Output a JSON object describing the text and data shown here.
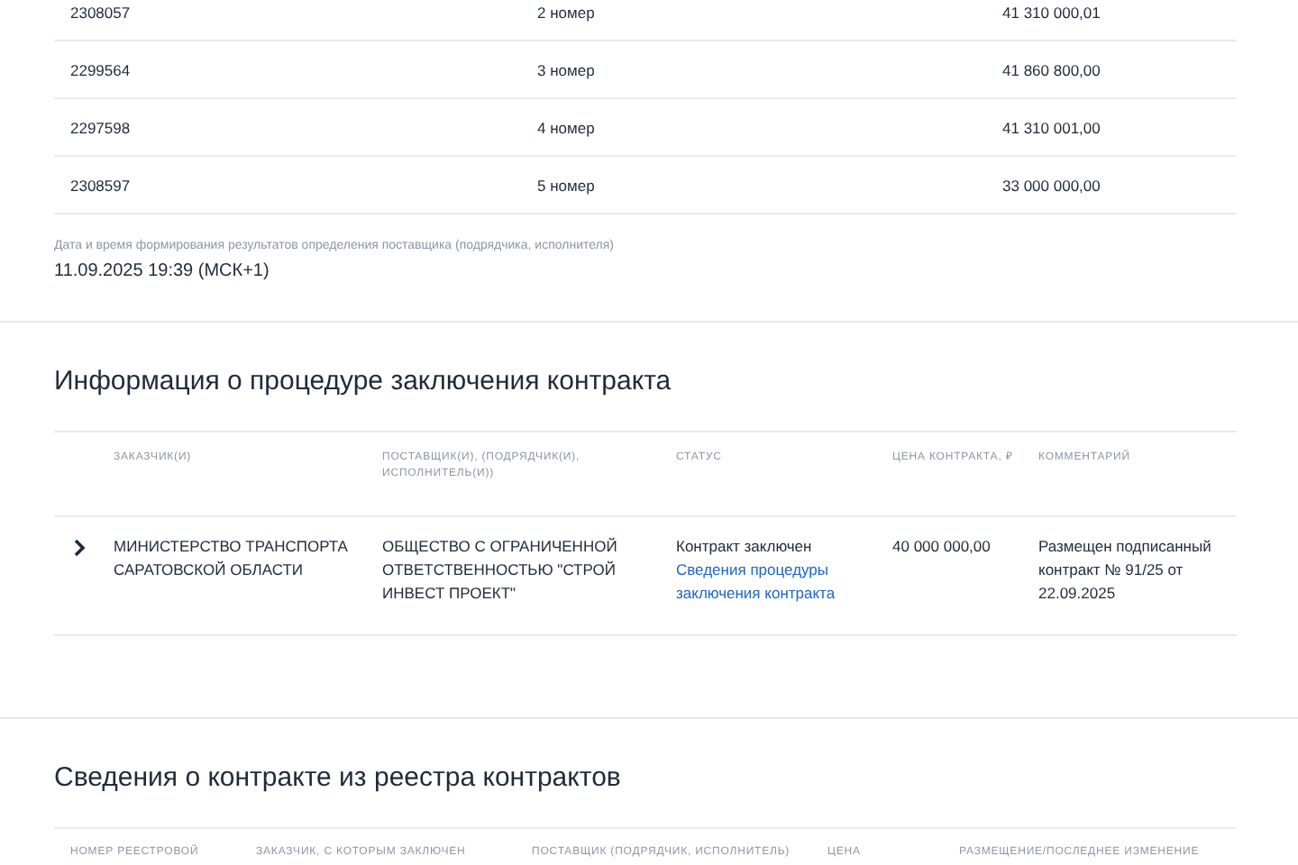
{
  "bids": [
    {
      "number": "2308057",
      "place": "2 номер",
      "price": "41 310 000,01"
    },
    {
      "number": "2299564",
      "place": "3 номер",
      "price": "41 860 800,00"
    },
    {
      "number": "2297598",
      "place": "4 номер",
      "price": "41 310 001,00"
    },
    {
      "number": "2308597",
      "place": "5 номер",
      "price": "33 000 000,00"
    }
  ],
  "result_date": {
    "label": "Дата и время формирования результатов определения поставщика (подрядчика, исполнителя)",
    "value": "11.09.2025 19:39 (МСК+1)"
  },
  "procedure": {
    "title": "Информация о процедуре заключения контракта",
    "columns": [
      "ЗАКАЗЧИК(И)",
      "ПОСТАВЩИК(И), (ПОДРЯДЧИК(И), ИСПОЛНИТЕЛЬ(И))",
      "СТАТУС",
      "ЦЕНА КОНТРАКТА, ₽",
      "КОММЕНТАРИЙ"
    ],
    "rows": [
      {
        "expanded": false,
        "customer": "МИНИСТЕРСТВО ТРАНСПОРТА САРАТОВСКОЙ ОБЛАСТИ",
        "supplier": "ОБЩЕСТВО С ОГРАНИЧЕННОЙ ОТВЕТСТВЕННОСТЬЮ \"СТРОЙ ИНВЕСТ ПРОЕКТ\"",
        "status": "Контракт заключен",
        "status_link": "Сведения процедуры заключения контракта",
        "price": "40 000 000,00",
        "comment": "Размещен подписанный контракт № 91/25 от 22.09.2025"
      }
    ]
  },
  "registry": {
    "title": "Сведения о контракте из реестра контрактов",
    "columns": [
      "НОМЕР РЕЕСТРОВОЙ",
      "ЗАКАЗЧИК, С КОТОРЫМ ЗАКЛЮЧЕН",
      "ПОСТАВЩИК (ПОДРЯДЧИК, ИСПОЛНИТЕЛЬ)",
      "ЦЕНА",
      "РАЗМЕЩЕНИЕ/ПОСЛЕДНЕЕ ИЗМЕНЕНИЕ"
    ]
  }
}
